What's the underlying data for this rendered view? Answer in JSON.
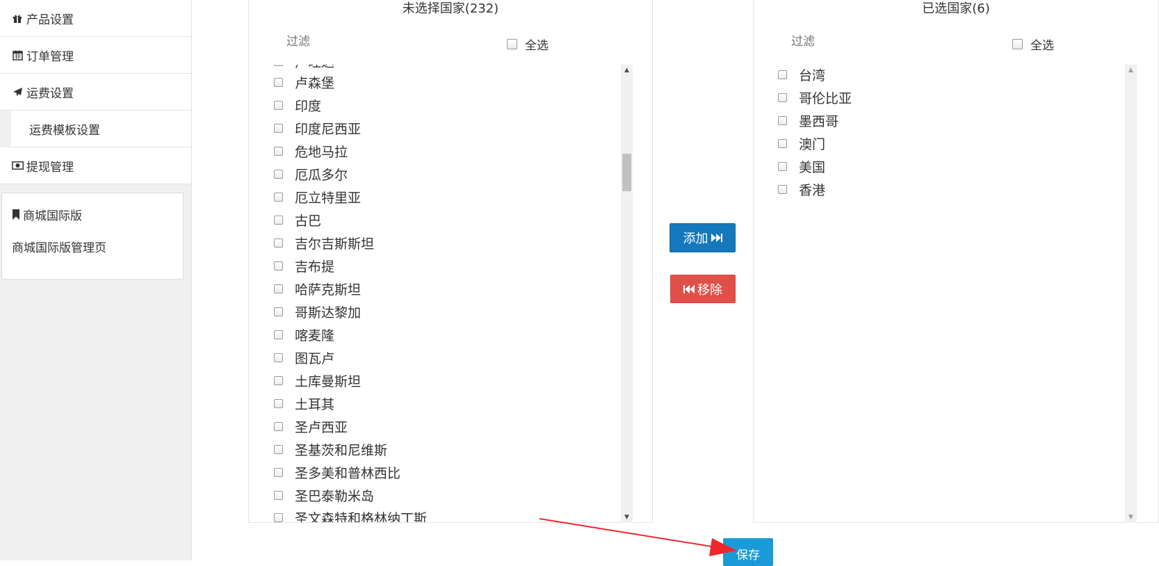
{
  "sidebar": {
    "items": [
      {
        "label": "产品设置",
        "icon": "gift-icon"
      },
      {
        "label": "订单管理",
        "icon": "calendar-icon"
      },
      {
        "label": "运费设置",
        "icon": "plane-icon"
      },
      {
        "label": "运费模板设置"
      },
      {
        "label": "提现管理",
        "icon": "money-icon"
      }
    ],
    "panel": {
      "title": "商城国际版",
      "icon": "bookmark-icon",
      "link": "商城国际版管理页"
    }
  },
  "unselected": {
    "title": "未选择国家(232)",
    "filter_placeholder": "过滤",
    "select_all": "全选",
    "items": [
      "卢旺达",
      "卢森堡",
      "印度",
      "印度尼西亚",
      "危地马拉",
      "厄瓜多尔",
      "厄立特里亚",
      "古巴",
      "吉尔吉斯斯坦",
      "吉布提",
      "哈萨克斯坦",
      "哥斯达黎加",
      "喀麦隆",
      "图瓦卢",
      "土库曼斯坦",
      "土耳其",
      "圣卢西亚",
      "圣基茨和尼维斯",
      "圣多美和普林西比",
      "圣巴泰勒米岛",
      "圣文森特和格林纳丁斯"
    ]
  },
  "selected": {
    "title": "已选国家(6)",
    "filter_placeholder": "过滤",
    "select_all": "全选",
    "items": [
      "台湾",
      "哥伦比亚",
      "墨西哥",
      "澳门",
      "美国",
      "香港"
    ]
  },
  "buttons": {
    "add": "添加",
    "remove": "移除",
    "save": "保存"
  },
  "colors": {
    "add": "#1478bb",
    "remove": "#e15048",
    "save": "#1a9ad6",
    "annotation_arrow": "#f0262a"
  }
}
